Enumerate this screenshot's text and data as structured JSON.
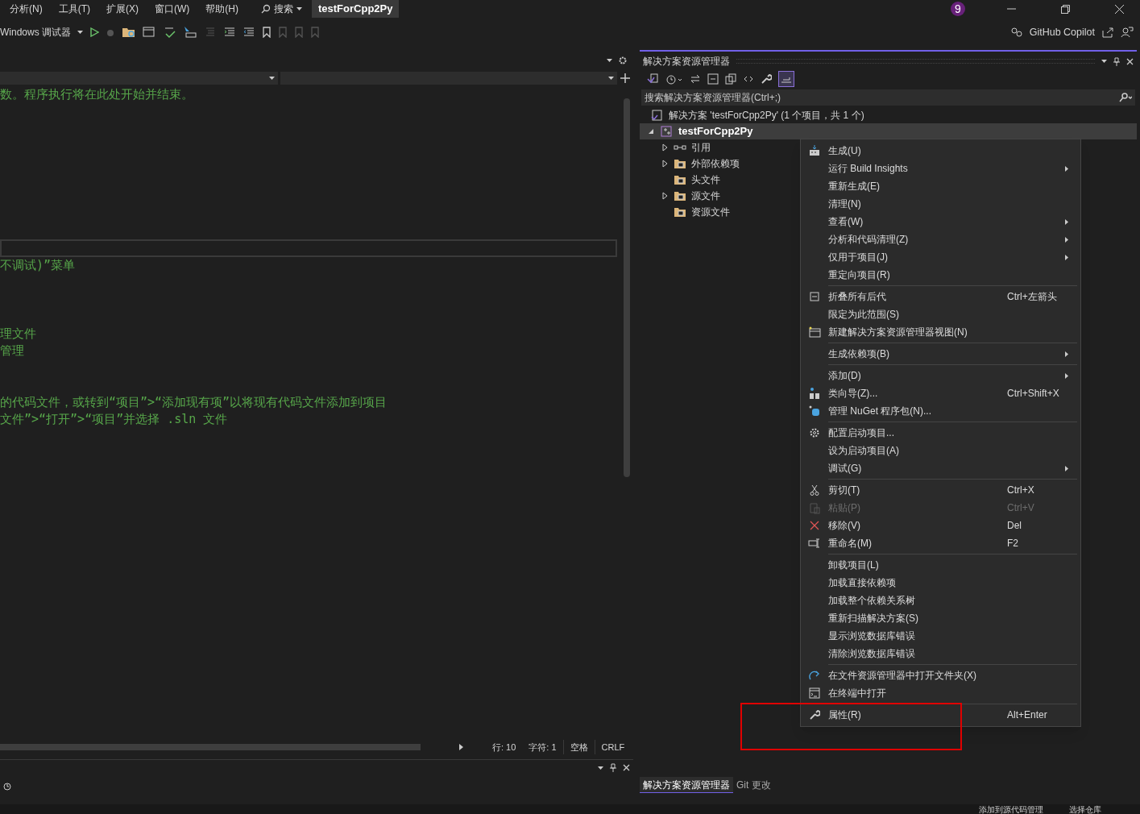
{
  "menubar": {
    "items": [
      "分析(N)",
      "工具(T)",
      "扩展(X)",
      "窗口(W)",
      "帮助(H)"
    ],
    "search": "搜索",
    "title": "testForCpp2Py",
    "badge": "9"
  },
  "toolbar": {
    "debugger": "Windows 调试器",
    "copilot": "GitHub Copilot"
  },
  "editor": {
    "comment_lines": [
      "数。程序执行将在此处开始并结束。",
      "不调试)”菜单",
      "理文件",
      "管理",
      "的代码文件，或转到“项目”>“添加现有项”以将现有代码文件添加到项目",
      "文件”>“打开”>“项目”并选择 .sln 文件"
    ],
    "status": [
      "行: 10",
      "字符: 1",
      "空格",
      "CRLF"
    ]
  },
  "solution_explorer": {
    "title": "解决方案资源管理器",
    "search": {
      "placeholder": "搜索解决方案资源管理器(Ctrl+;)"
    },
    "solution": "解决方案 'testForCpp2Py' (1 个项目，共 1 个)",
    "project": {
      "label": "testForCpp2Py",
      "selected": true,
      "expanded": true,
      "children": [
        {
          "label": "引用",
          "expandable": true
        },
        {
          "label": "外部依赖项",
          "expandable": true
        },
        {
          "label": "头文件",
          "expandable": false
        },
        {
          "label": "源文件",
          "expandable": true
        },
        {
          "label": "资源文件",
          "expandable": false
        }
      ]
    },
    "tabs": [
      {
        "label": "解决方案资源管理器",
        "selected": true
      },
      {
        "label": "Git 更改",
        "selected": false
      }
    ]
  },
  "context_menu": [
    {
      "kind": "item",
      "label": "生成(U)"
    },
    {
      "kind": "item",
      "label": "运行 Build Insights",
      "submenu": true
    },
    {
      "kind": "item",
      "label": "重新生成(E)"
    },
    {
      "kind": "item",
      "label": "清理(N)"
    },
    {
      "kind": "item",
      "label": "查看(W)",
      "submenu": true
    },
    {
      "kind": "item",
      "label": "分析和代码清理(Z)",
      "submenu": true
    },
    {
      "kind": "item",
      "label": "仅用于项目(J)",
      "submenu": true
    },
    {
      "kind": "item",
      "label": "重定向项目(R)"
    },
    {
      "kind": "separator"
    },
    {
      "kind": "item",
      "label": "折叠所有后代",
      "shortcut": "Ctrl+左箭头"
    },
    {
      "kind": "item",
      "label": "限定为此范围(S)"
    },
    {
      "kind": "item",
      "label": "新建解决方案资源管理器视图(N)"
    },
    {
      "kind": "separator"
    },
    {
      "kind": "item",
      "label": "生成依赖项(B)",
      "submenu": true
    },
    {
      "kind": "separator"
    },
    {
      "kind": "item",
      "label": "添加(D)",
      "submenu": true
    },
    {
      "kind": "item",
      "label": "类向导(Z)...",
      "shortcut": "Ctrl+Shift+X"
    },
    {
      "kind": "item",
      "label": "管理 NuGet 程序包(N)..."
    },
    {
      "kind": "separator"
    },
    {
      "kind": "item",
      "label": "配置启动项目..."
    },
    {
      "kind": "item",
      "label": "设为启动项目(A)"
    },
    {
      "kind": "item",
      "label": "调试(G)",
      "submenu": true
    },
    {
      "kind": "separator"
    },
    {
      "kind": "item",
      "label": "剪切(T)",
      "shortcut": "Ctrl+X"
    },
    {
      "kind": "item",
      "label": "粘贴(P)",
      "shortcut": "Ctrl+V",
      "disabled": true
    },
    {
      "kind": "item",
      "label": "移除(V)",
      "shortcut": "Del"
    },
    {
      "kind": "item",
      "label": "重命名(M)",
      "shortcut": "F2"
    },
    {
      "kind": "separator"
    },
    {
      "kind": "item",
      "label": "卸载项目(L)"
    },
    {
      "kind": "item",
      "label": "加载直接依赖项"
    },
    {
      "kind": "item",
      "label": "加载整个依赖关系树"
    },
    {
      "kind": "item",
      "label": "重新扫描解决方案(S)"
    },
    {
      "kind": "item",
      "label": "显示浏览数据库错误"
    },
    {
      "kind": "item",
      "label": "清除浏览数据库错误"
    },
    {
      "kind": "separator"
    },
    {
      "kind": "item",
      "label": "在文件资源管理器中打开文件夹(X)"
    },
    {
      "kind": "item",
      "label": "在终端中打开"
    },
    {
      "kind": "separator"
    },
    {
      "kind": "item",
      "label": "属性(R)",
      "shortcut": "Alt+Enter"
    }
  ],
  "status_bar": [
    "添加到源代码管理",
    "选择仓库"
  ]
}
